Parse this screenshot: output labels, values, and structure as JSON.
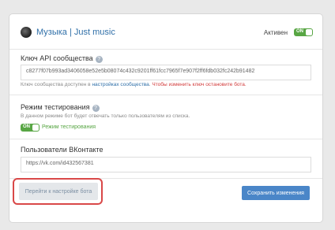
{
  "header": {
    "bot_name": "Музыка | Just music",
    "status_label": "Активен",
    "toggle_label": "ON"
  },
  "api_key": {
    "title": "Ключ API сообщества",
    "value": "c8277f07b993ad3406058e52e5b08074c432c9201ff61fcc7965f7e907f2ff6fdb032fc242b91482",
    "note_prefix": "Ключ сообщества доступен в ",
    "note_link": "настройках сообщества",
    "note_mid": ". ",
    "note_warning": "Чтобы изменить ключ остановите бота."
  },
  "test_mode": {
    "title": "Режим тестирования",
    "description": "В данном режиме бот будет отвечать только пользователям из списка.",
    "toggle_label": "ON",
    "toggle_text": "Режим тестирования"
  },
  "vk_users": {
    "title": "Пользователи ВКонтакте",
    "value": "https://vk.com/id432567381"
  },
  "buttons": {
    "go_to_settings": "Перейти к настройке бота",
    "save_changes": "Сохранить изменения"
  },
  "colors": {
    "accent": "#4a86c8",
    "toggle_on": "#58a644",
    "warning": "#d23b3b",
    "highlight": "#d94848"
  }
}
